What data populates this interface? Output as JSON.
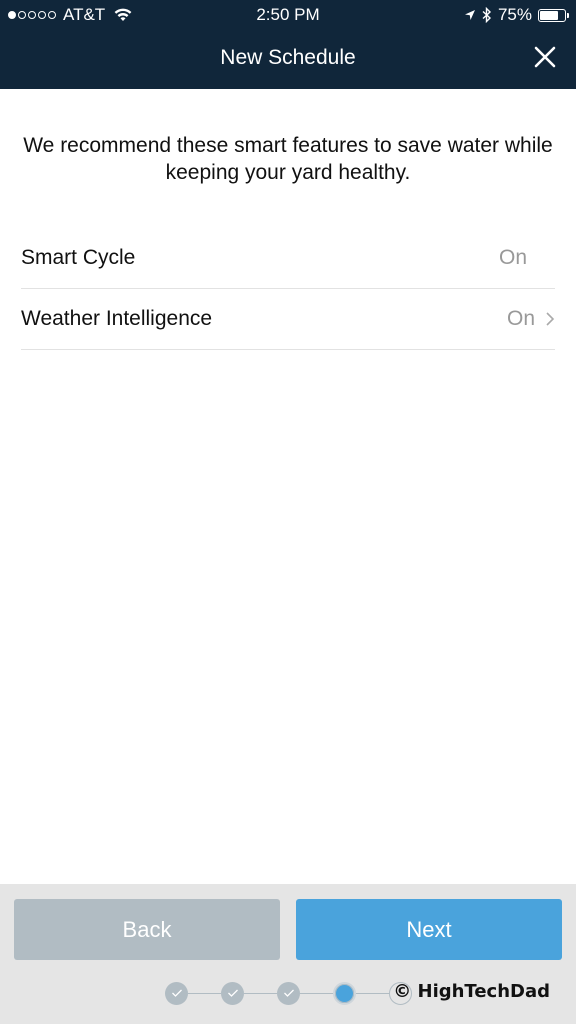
{
  "status_bar": {
    "signal_filled": 1,
    "signal_total": 5,
    "carrier": "AT&T",
    "time": "2:50 PM",
    "battery": "75%",
    "battery_level": 0.75
  },
  "header": {
    "title": "New Schedule",
    "close_icon": "close-icon"
  },
  "intro_text": "We recommend these smart features to save water while keeping your yard healthy.",
  "features": [
    {
      "label": "Smart Cycle",
      "value": "On",
      "has_chevron": false
    },
    {
      "label": "Weather Intelligence",
      "value": "On",
      "has_chevron": true
    }
  ],
  "footer": {
    "back_label": "Back",
    "next_label": "Next",
    "steps": {
      "total": 5,
      "current": 4,
      "completed": 3
    },
    "watermark": "© HighTechDad"
  },
  "colors": {
    "header_bg": "#10263a",
    "accent": "#4aa3dc",
    "disabled": "#b1bcc3",
    "footer_bg": "#e5e5e5"
  }
}
